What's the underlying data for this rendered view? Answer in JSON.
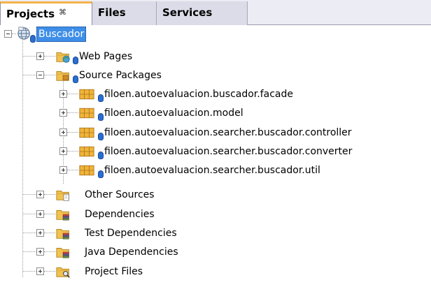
{
  "tabs": [
    {
      "label": "Projects",
      "active": true
    },
    {
      "label": "Files",
      "active": false
    },
    {
      "label": "Services",
      "active": false
    }
  ],
  "tab_close_glyph": "⌘",
  "tree": {
    "root": {
      "label": "Buscador",
      "icon": "globe-project-icon"
    },
    "web_pages": {
      "label": "Web Pages",
      "icon": "web-folder-icon"
    },
    "source_packages": {
      "label": "Source Packages",
      "icon": "source-folder-icon",
      "packages": [
        {
          "label": "filoen.autoevaluacion.buscador.facade"
        },
        {
          "label": "filoen.autoevaluacion.model"
        },
        {
          "label": "filoen.autoevaluacion.searcher.buscador.controller"
        },
        {
          "label": "filoen.autoevaluacion.searcher.buscador.converter"
        },
        {
          "label": "filoen.autoevaluacion.searcher.buscador.util"
        }
      ]
    },
    "other_sources": {
      "label": "Other Sources"
    },
    "dependencies": {
      "label": "Dependencies"
    },
    "test_dependencies": {
      "label": "Test Dependencies"
    },
    "java_dependencies": {
      "label": "Java Dependencies"
    },
    "project_files": {
      "label": "Project Files"
    }
  },
  "colors": {
    "selection": "#3d8ee8",
    "folder": "#f2c14e",
    "package": "#f0b43a",
    "badge": "#2a6fd0",
    "tab_accent": "#f4b24a"
  }
}
